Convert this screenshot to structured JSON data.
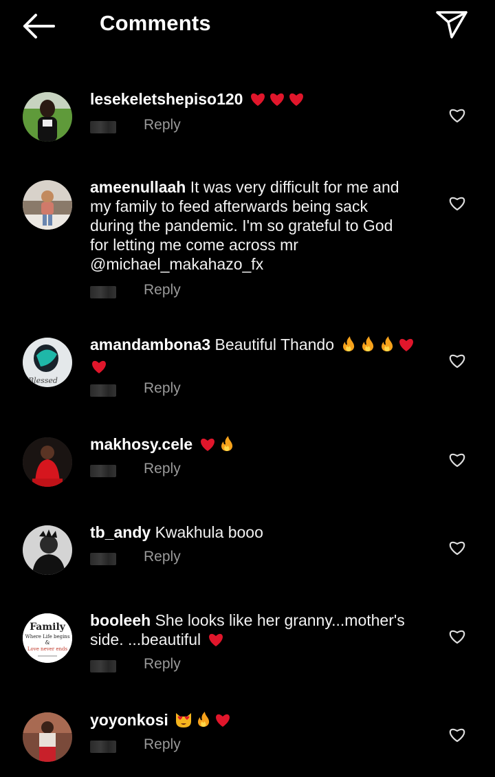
{
  "header": {
    "title": "Comments",
    "back_icon": "arrow-left-icon",
    "send_icon": "paper-plane-icon"
  },
  "colors": {
    "background": "#000000",
    "text": "#ffffff",
    "secondary_text": "#9a9a9a",
    "heart": "#e0162b",
    "fire": "#f7a21b"
  },
  "reply_label": "Reply",
  "comments": [
    {
      "username": "lesekeletshepiso120",
      "text": "",
      "emojis": [
        "red-heart",
        "red-heart",
        "red-heart"
      ],
      "reply": "Reply"
    },
    {
      "username": "ameenullaah",
      "text": "It was very difficult for me and my family to feed afterwards being sack during the pandemic. I'm so grateful to God for letting me come across mr @michael_makahazo_fx",
      "emojis": [],
      "reply": "Reply"
    },
    {
      "username": "amandambona3",
      "text": "Beautiful Thando",
      "emojis": [
        "fire",
        "fire",
        "fire",
        "red-heart",
        "red-heart"
      ],
      "reply": "Reply"
    },
    {
      "username": "makhosy.cele",
      "text": "",
      "emojis": [
        "red-heart",
        "fire"
      ],
      "reply": "Reply"
    },
    {
      "username": "tb_andy",
      "text": "Kwakhula booo",
      "emojis": [],
      "reply": "Reply"
    },
    {
      "username": "booleeh",
      "text": "She looks like her granny...mother's side. ...beautiful",
      "emojis": [
        "red-heart"
      ],
      "reply": "Reply"
    },
    {
      "username": "yoyonkosi",
      "text": "",
      "emojis": [
        "heart-eyes-cat",
        "fire",
        "red-heart"
      ],
      "reply": "Reply"
    }
  ],
  "avatar_family": {
    "line1": "Family",
    "line2": "Where Life begins",
    "line3": "&",
    "line4": "Love never ends"
  }
}
